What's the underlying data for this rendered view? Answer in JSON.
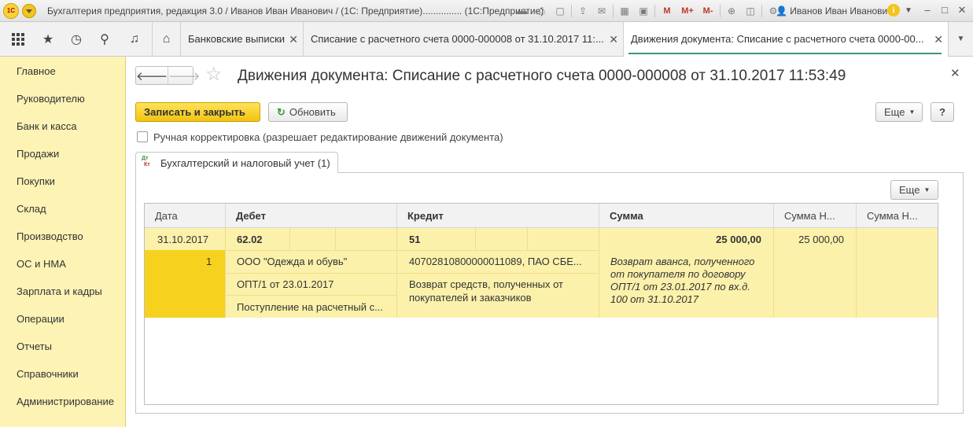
{
  "window": {
    "logo": "1С",
    "title": "Бухгалтерия предприятия, редакция 3.0 / Иванов Иван Иванович / (1С: Предприятие)...............  (1С:Предприятие)",
    "toolbar": {
      "m": "M",
      "m_plus": "M+",
      "m_minus": "M-"
    },
    "user": "Иванов Иван Иванович"
  },
  "tabs": [
    {
      "label": "Банковские выписки"
    },
    {
      "label": "Списание с расчетного счета 0000-000008 от 31.10.2017 11:..."
    },
    {
      "label": "Движения документа: Списание с расчетного счета 0000-00..."
    }
  ],
  "sidebar": {
    "items": [
      "Главное",
      "Руководителю",
      "Банк и касса",
      "Продажи",
      "Покупки",
      "Склад",
      "Производство",
      "ОС и НМА",
      "Зарплата и кадры",
      "Операции",
      "Отчеты",
      "Справочники",
      "Администрирование"
    ]
  },
  "form": {
    "title": "Движения документа: Списание с расчетного счета 0000-000008 от 31.10.2017 11:53:49",
    "save_close": "Записать и закрыть",
    "refresh": "Обновить",
    "more": "Еще",
    "help": "?",
    "manual_label": "Ручная корректировка (разрешает редактирование движений документа)",
    "tab_icon_top": "Дт",
    "tab_icon_bottom": "Кт",
    "tab_label": "Бухгалтерский и налоговый учет (1)",
    "grid_more": "Еще"
  },
  "table": {
    "headers": [
      "Дата",
      "Дебет",
      "Кредит",
      "Сумма",
      "Сумма Н...",
      "Сумма Н..."
    ],
    "row": {
      "date": "31.10.2017",
      "number": "1",
      "debit_account": "62.02",
      "debit_sub1": "ООО \"Одежда и обувь\"",
      "debit_sub2": "ОПТ/1 от 23.01.2017",
      "debit_sub3": "Поступление на расчетный с...",
      "credit_account": "51",
      "credit_sub1": "40702810800000011089, ПАО СБЕ...",
      "credit_sub2": "Возврат средств, полученных от покупателей и заказчиков",
      "amount": "25 000,00",
      "description": "Возврат аванса, полученного от покупателя по договору ОПТ/1 от 23.01.2017 по вх.д. 100 от 31.10.2017",
      "amount_nu": "25 000,00"
    }
  }
}
